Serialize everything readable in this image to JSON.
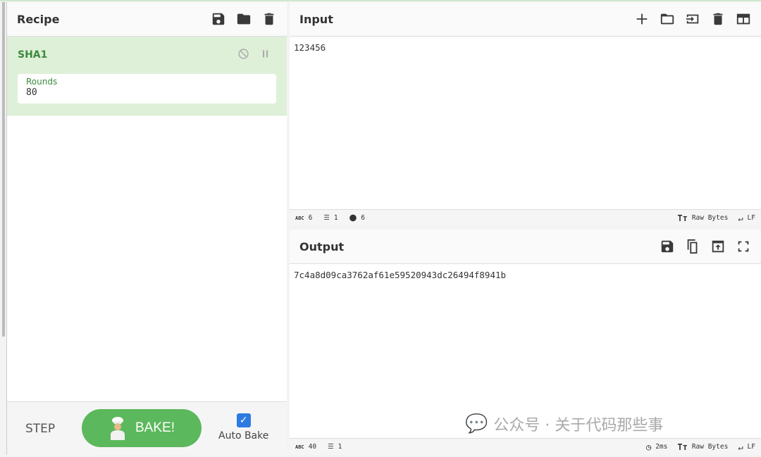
{
  "recipe": {
    "title": "Recipe",
    "operation": {
      "name": "SHA1",
      "args": [
        {
          "label": "Rounds",
          "value": "80"
        }
      ]
    },
    "step_label": "STEP",
    "bake_label": "BAKE!",
    "auto_bake_label": "Auto Bake",
    "auto_bake_checked": true
  },
  "input": {
    "title": "Input",
    "value": "123456",
    "status": {
      "length": "6",
      "lines": "1",
      "position": "6",
      "encoding": "Raw Bytes",
      "eol": "LF"
    }
  },
  "output": {
    "title": "Output",
    "value": "7c4a8d09ca3762af61e59520943dc26494f8941b",
    "status": {
      "length": "40",
      "lines": "1",
      "time": "2ms",
      "encoding": "Raw Bytes",
      "eol": "LF"
    }
  },
  "watermark": "公众号 · 关于代码那些事",
  "colors": {
    "accent": "#5cb85c",
    "op_bg": "#dff0d8",
    "checkbox": "#2d7be0"
  }
}
